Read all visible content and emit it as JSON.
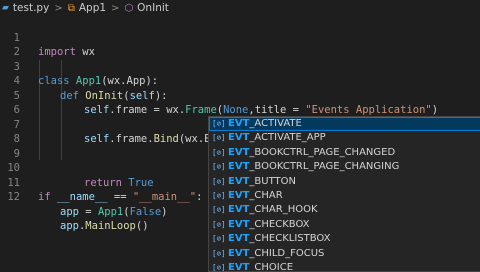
{
  "breadcrumb": {
    "file": "test.py",
    "class_name": "App1",
    "method": "OnInit",
    "file_icon": "python-file-icon",
    "class_icon": "class-icon",
    "method_icon": "method-icon",
    "separator": ">"
  },
  "line_numbers": [
    "1",
    "2",
    "3",
    "4",
    "5",
    "6",
    "7",
    "8",
    "9",
    "10",
    "11",
    "12"
  ],
  "code": {
    "l1_kw": "import",
    "l1_mod": " wx",
    "l3_kw": "class",
    "l3_cls": " App1",
    "l3_rest": "(wx.App):",
    "l4_kw": "def",
    "l4_fn": " OnInit",
    "l4_p1": "(",
    "l4_self": "self",
    "l4_p2": "):",
    "l5_self": "self",
    "l5_a": ".frame = wx.",
    "l5_cls": "Frame",
    "l5_b": "(",
    "l5_none": "None",
    "l5_c": ",title = ",
    "l5_str": "\"Events Application\"",
    "l5_d": ")",
    "l7_self": "self",
    "l7_a": ".frame.",
    "l7_fn": "Bind",
    "l7_b": "(wx.EVT",
    "l7_c": ")",
    "l10_kw": "return",
    "l10_val": " True",
    "l11_kw": "if",
    "l11_var": " __name__",
    "l11_op": " == ",
    "l11_str": "\"__main__\"",
    "l11_col": ":",
    "l12_var": "app",
    "l12_a": " = ",
    "l12_cls": "App1",
    "l12_b": "(",
    "l12_false": "False",
    "l12_c": ")",
    "l13_var": "app",
    "l13_a": ".",
    "l13_fn": "MainLoop",
    "l13_b": "()"
  },
  "suggestions": {
    "icon_glyph": "[⊘]",
    "match_prefix": "EVT",
    "items": [
      {
        "rest": "_ACTIVATE"
      },
      {
        "rest": "_ACTIVATE_APP"
      },
      {
        "rest": "_BOOKCTRL_PAGE_CHANGED"
      },
      {
        "rest": "_BOOKCTRL_PAGE_CHANGING"
      },
      {
        "rest": "_BUTTON"
      },
      {
        "rest": "_CHAR"
      },
      {
        "rest": "_CHAR_HOOK"
      },
      {
        "rest": "_CHECKBOX"
      },
      {
        "rest": "_CHECKLISTBOX"
      },
      {
        "rest": "_CHILD_FOCUS"
      },
      {
        "rest": "_CHOICE"
      }
    ]
  },
  "colors": {
    "background": "#1e1e1e",
    "keyword": "#569cd6",
    "control_keyword": "#c586c0",
    "class": "#4ec9b0",
    "function": "#dcdcaa",
    "string": "#ce9178",
    "variable": "#9cdcfe",
    "suggest_match": "#18a3ff",
    "suggest_selected": "#04395e"
  }
}
